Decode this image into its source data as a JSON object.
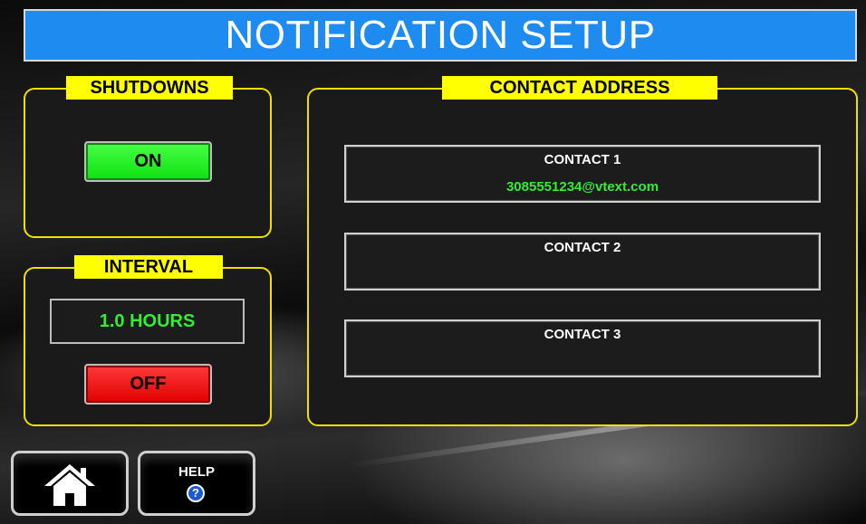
{
  "title": "NOTIFICATION SETUP",
  "shutdowns": {
    "label": "SHUTDOWNS",
    "button_label": "ON",
    "button_state_color": "#22ee22"
  },
  "interval": {
    "label": "INTERVAL",
    "value": "1.0 HOURS",
    "button_label": "OFF",
    "button_state_color": "#ee1111"
  },
  "contacts": {
    "label": "CONTACT ADDRESS",
    "items": [
      {
        "title": "CONTACT 1",
        "value": "3085551234@vtext.com"
      },
      {
        "title": "CONTACT 2",
        "value": ""
      },
      {
        "title": "CONTACT 3",
        "value": ""
      }
    ]
  },
  "nav": {
    "home_icon": "home-icon",
    "help_label": "HELP",
    "help_icon": "question-icon"
  },
  "colors": {
    "title_bar": "#1e8bf0",
    "panel_border": "#f0e000",
    "label_bg": "#ffff00",
    "value_text": "#33ee33"
  }
}
